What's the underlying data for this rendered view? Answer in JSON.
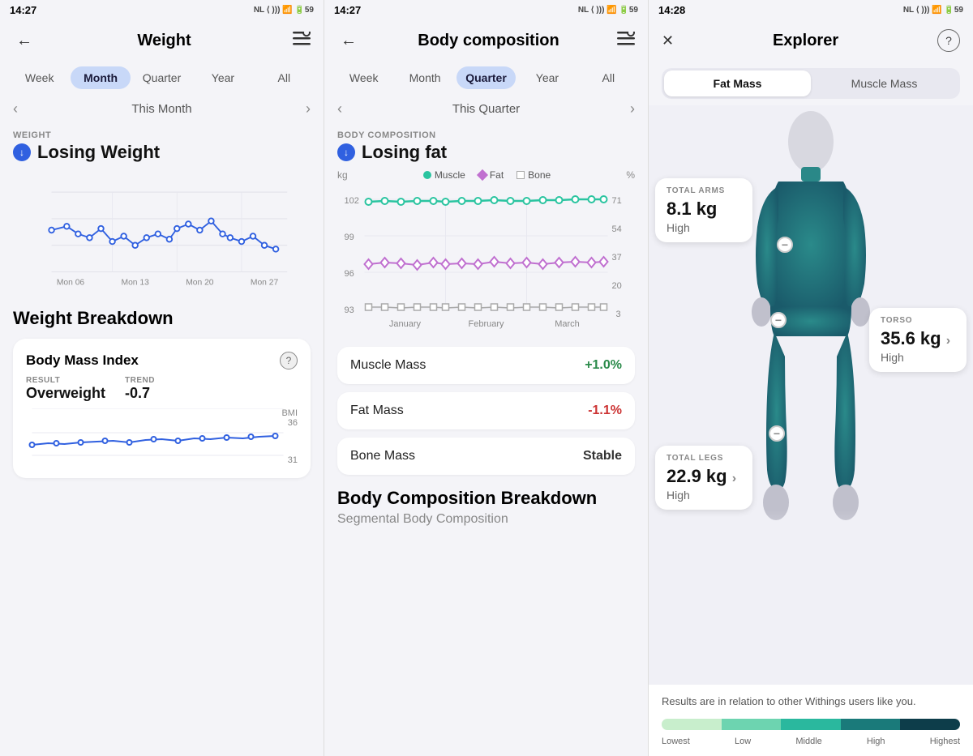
{
  "panels": [
    {
      "id": "weight",
      "statusTime": "14:27",
      "statusIcons": "NL 🔕 ⟨ ))) 📶 🔋59",
      "backLabel": "←",
      "title": "Weight",
      "menuIcon": "≡",
      "periodTabs": [
        "Week",
        "Month",
        "Quarter",
        "Year",
        "All"
      ],
      "activePeriod": "Month",
      "navPrev": "‹",
      "navNext": "›",
      "navLabel": "This Month",
      "sectionLabel": "WEIGHT",
      "trendText": "Losing Weight",
      "weightChartDates": [
        "Mon 06",
        "Mon 13",
        "Mon 20",
        "Mon 27"
      ],
      "breakdownTitle": "Weight Breakdown",
      "bmiTitle": "Body Mass Index",
      "bmiResultLabel": "RESULT",
      "bmiResultValue": "Overweight",
      "bmiTrendLabel": "TREND",
      "bmiTrendValue": "-0.7",
      "bmiUnit": "BMI",
      "bmiValues": [
        "36",
        "31"
      ]
    }
  ],
  "panel2": {
    "statusTime": "14:27",
    "title": "Body composition",
    "activePeriod": "Quarter",
    "periodTabs": [
      "Week",
      "Month",
      "Quarter",
      "Year",
      "All"
    ],
    "navLabel": "This Quarter",
    "sectionLabel": "BODY COMPOSITION",
    "trendText": "Losing fat",
    "legendMuscle": "Muscle",
    "legendFat": "Fat",
    "legendBone": "Bone",
    "chartYLeft": [
      "102",
      "99",
      "96",
      "93"
    ],
    "chartYRight": [
      "71",
      "54",
      "37",
      "20",
      "3"
    ],
    "chartXLabels": [
      "January",
      "February",
      "March"
    ],
    "massItems": [
      {
        "label": "Muscle Mass",
        "value": "+1.0%",
        "type": "positive"
      },
      {
        "label": "Fat Mass",
        "value": "-1.1%",
        "type": "negative"
      },
      {
        "label": "Bone Mass",
        "value": "Stable",
        "type": "stable"
      }
    ],
    "breakdownTitle": "Body Composition Breakdown",
    "segmentalLabel": "Segmental Body Composition"
  },
  "panel3": {
    "statusTime": "14:28",
    "title": "Explorer",
    "helpIcon": "?",
    "tabs": [
      "Fat Mass",
      "Muscle Mass"
    ],
    "activeTab": "Fat Mass",
    "bodyRegions": [
      {
        "id": "arms",
        "region": "TOTAL ARMS",
        "value": "8.1 kg",
        "status": "High",
        "hasArrow": false,
        "cardClass": "card-arms"
      },
      {
        "id": "torso",
        "region": "TORSO",
        "value": "35.6 kg",
        "status": "High",
        "hasArrow": true,
        "cardClass": "card-torso"
      },
      {
        "id": "legs",
        "region": "TOTAL LEGS",
        "value": "22.9 kg",
        "status": "High",
        "hasArrow": true,
        "cardClass": "card-legs"
      }
    ],
    "legendText": "Results are in relation to other Withings users like you.",
    "legendLabels": [
      "Lowest",
      "Low",
      "Middle",
      "High",
      "Highest"
    ],
    "legendColors": [
      "#c8eecc",
      "#6dd4b0",
      "#2ab89e",
      "#1a7a7a",
      "#0d3d4a"
    ]
  }
}
